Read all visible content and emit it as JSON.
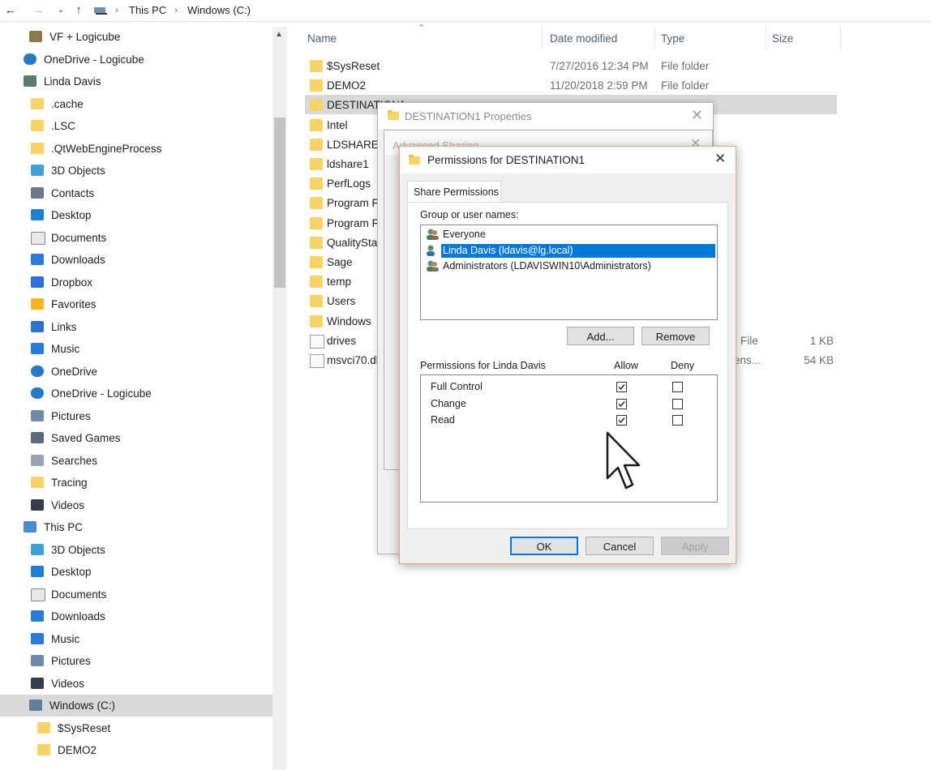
{
  "address": {
    "crumbs": [
      "This PC",
      "Windows (C:)"
    ]
  },
  "nav": {
    "items": [
      {
        "label": "VF + Logicube",
        "icon": "user-folder-icon"
      },
      {
        "label": "OneDrive - Logicube",
        "icon": "onedrive-icon"
      },
      {
        "label": "Linda Davis",
        "icon": "user-icon"
      },
      {
        "label": ".cache",
        "icon": "folder-icon"
      },
      {
        "label": ".LSC",
        "icon": "folder-icon"
      },
      {
        "label": ".QtWebEngineProcess",
        "icon": "folder-icon"
      },
      {
        "label": "3D Objects",
        "icon": "3d-objects-icon"
      },
      {
        "label": "Contacts",
        "icon": "contacts-icon"
      },
      {
        "label": "Desktop",
        "icon": "desktop-icon"
      },
      {
        "label": "Documents",
        "icon": "documents-icon"
      },
      {
        "label": "Downloads",
        "icon": "downloads-icon"
      },
      {
        "label": "Dropbox",
        "icon": "dropbox-icon"
      },
      {
        "label": "Favorites",
        "icon": "favorites-icon"
      },
      {
        "label": "Links",
        "icon": "links-icon"
      },
      {
        "label": "Music",
        "icon": "music-icon"
      },
      {
        "label": "OneDrive",
        "icon": "onedrive-icon"
      },
      {
        "label": "OneDrive - Logicube",
        "icon": "onedrive-icon"
      },
      {
        "label": "Pictures",
        "icon": "pictures-icon"
      },
      {
        "label": "Saved Games",
        "icon": "saved-games-icon"
      },
      {
        "label": "Searches",
        "icon": "searches-icon"
      },
      {
        "label": "Tracing",
        "icon": "folder-icon"
      },
      {
        "label": "Videos",
        "icon": "videos-icon"
      },
      {
        "label": "This PC",
        "icon": "this-pc-icon"
      },
      {
        "label": "3D Objects",
        "icon": "3d-objects-icon"
      },
      {
        "label": "Desktop",
        "icon": "desktop-icon"
      },
      {
        "label": "Documents",
        "icon": "documents-icon"
      },
      {
        "label": "Downloads",
        "icon": "downloads-icon"
      },
      {
        "label": "Music",
        "icon": "music-icon"
      },
      {
        "label": "Pictures",
        "icon": "pictures-icon"
      },
      {
        "label": "Videos",
        "icon": "videos-icon"
      },
      {
        "label": "Windows (C:)",
        "icon": "drive-icon"
      },
      {
        "label": "$SysReset",
        "icon": "folder-icon"
      },
      {
        "label": "DEMO2",
        "icon": "folder-icon"
      }
    ]
  },
  "columns": {
    "name": "Name",
    "date": "Date modified",
    "type": "Type",
    "size": "Size"
  },
  "files": [
    {
      "name": "$SysReset",
      "date": "7/27/2016 12:34 PM",
      "type": "File folder",
      "size": ""
    },
    {
      "name": "DEMO2",
      "date": "11/20/2018 2:59 PM",
      "type": "File folder",
      "size": ""
    },
    {
      "name": "DESTINATION1",
      "date": "",
      "type": "",
      "size": ""
    },
    {
      "name": "Intel",
      "date": "",
      "type": "",
      "size": ""
    },
    {
      "name": "LDSHARE",
      "date": "",
      "type": "",
      "size": ""
    },
    {
      "name": "ldshare1",
      "date": "",
      "type": "",
      "size": ""
    },
    {
      "name": "PerfLogs",
      "date": "",
      "type": "",
      "size": ""
    },
    {
      "name": "Program F",
      "date": "",
      "type": "",
      "size": ""
    },
    {
      "name": "Program F",
      "date": "",
      "type": "",
      "size": ""
    },
    {
      "name": "QualitySta",
      "date": "",
      "type": "",
      "size": ""
    },
    {
      "name": "Sage",
      "date": "",
      "type": "",
      "size": ""
    },
    {
      "name": "temp",
      "date": "",
      "type": "",
      "size": ""
    },
    {
      "name": "Users",
      "date": "",
      "type": "",
      "size": ""
    },
    {
      "name": "Windows",
      "date": "",
      "type": "",
      "size": ""
    },
    {
      "name": "drives",
      "date": "",
      "type": "File",
      "size": "1 KB"
    },
    {
      "name": "msvci70.dl",
      "date": "",
      "type": "ens...",
      "size": "54 KB"
    }
  ],
  "props_dialog": {
    "title": "DESTINATION1 Properties"
  },
  "adv_dialog": {
    "title": "Advanced Sharing"
  },
  "perm_dialog": {
    "title": "Permissions for DESTINATION1",
    "tab": "Share Permissions",
    "group_label": "Group or user names:",
    "users": [
      {
        "name": "Everyone",
        "selected": false
      },
      {
        "name": "Linda Davis (ldavis@lg.local)",
        "selected": true
      },
      {
        "name": "Administrators (LDAVISWIN10\\Administrators)",
        "selected": false
      }
    ],
    "add_label": "Add...",
    "remove_label": "Remove",
    "perm_header": "Permissions for Linda Davis",
    "allow_header": "Allow",
    "deny_header": "Deny",
    "permissions": [
      {
        "name": "Full Control",
        "allow": true,
        "deny": false
      },
      {
        "name": "Change",
        "allow": true,
        "deny": false
      },
      {
        "name": "Read",
        "allow": true,
        "deny": false
      }
    ],
    "ok_label": "OK",
    "cancel_label": "Cancel",
    "apply_label": "Apply"
  },
  "colors": {
    "folder": "#f7d468",
    "selection": "#d9d9d9",
    "list_selection": "#0078d7",
    "header_text": "#4c607a",
    "dialog_bg": "#f0f0f0"
  }
}
